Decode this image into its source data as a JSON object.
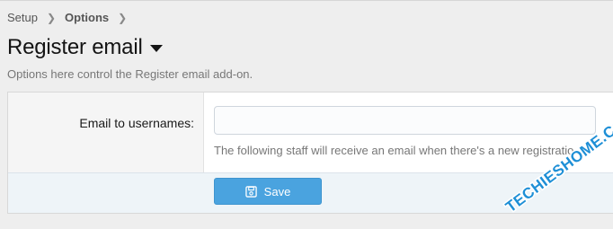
{
  "breadcrumb": {
    "items": [
      "Setup",
      "Options"
    ],
    "separator_icon": "chevron-right-icon"
  },
  "page": {
    "title": "Register email",
    "description": "Options here control the Register email add-on."
  },
  "form": {
    "field_label": "Email to usernames:",
    "field_value": "",
    "hint": "The following staff will receive an email when there's a new registratio",
    "save_label": "Save",
    "save_icon": "save-icon"
  },
  "watermark": {
    "text": "TECHIESHOME.COM"
  },
  "colors": {
    "button_blue": "#4aa3df",
    "watermark_blue": "#1e8fd6"
  }
}
